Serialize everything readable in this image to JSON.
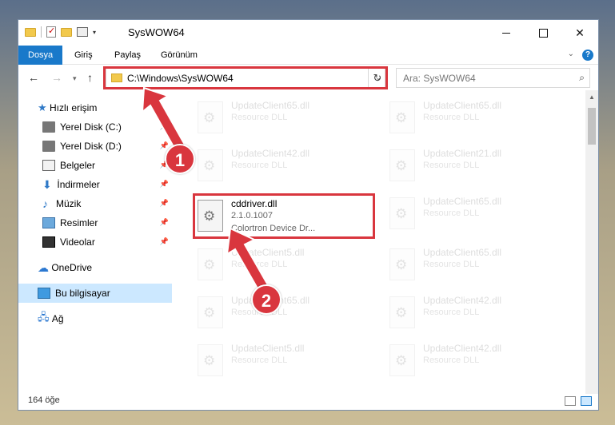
{
  "window": {
    "title": "SysWOW64"
  },
  "ribbon": {
    "tabs": [
      "Dosya",
      "Giriş",
      "Paylaş",
      "Görünüm"
    ]
  },
  "address": {
    "path": "C:\\Windows\\SysWOW64"
  },
  "search": {
    "placeholder": "Ara: SysWOW64"
  },
  "sidebar": {
    "items": [
      {
        "label": "Hızlı erişim",
        "icon": "star-icon"
      },
      {
        "label": "Yerel Disk (C:)",
        "icon": "drive-icon"
      },
      {
        "label": "Yerel Disk (D:)",
        "icon": "drive-icon"
      },
      {
        "label": "Belgeler",
        "icon": "documents-icon"
      },
      {
        "label": "İndirmeler",
        "icon": "downloads-icon"
      },
      {
        "label": "Müzik",
        "icon": "music-icon"
      },
      {
        "label": "Resimler",
        "icon": "pictures-icon"
      },
      {
        "label": "Videolar",
        "icon": "videos-icon"
      },
      {
        "label": "OneDrive",
        "icon": "cloud-icon"
      },
      {
        "label": "Bu bilgisayar",
        "icon": "computer-icon"
      },
      {
        "label": "Ağ",
        "icon": "network-icon"
      }
    ]
  },
  "files": {
    "left": [
      {
        "name": "UpdateClient65.dll",
        "type": "Resource DLL"
      },
      {
        "name": "UpdateClient42.dll",
        "type": "Resource DLL"
      },
      {
        "name": "cddriver.dll",
        "version": "2.1.0.1007",
        "company": "Colortron Device Dr..."
      },
      {
        "name": "UpdateClient5.dll",
        "type": "Resource DLL"
      },
      {
        "name": "UpdateClient65.dll",
        "type": "Resource DLL"
      },
      {
        "name": "UpdateClient5.dll",
        "type": "Resource DLL"
      }
    ],
    "right": [
      {
        "name": "UpdateClient65.dll",
        "type": "Resource DLL"
      },
      {
        "name": "UpdateClient21.dll",
        "type": "Resource DLL"
      },
      {
        "name": "UpdateClient65.dll",
        "type": "Resource DLL"
      },
      {
        "name": "UpdateClient65.dll",
        "type": "Resource DLL"
      },
      {
        "name": "UpdateClient42.dll",
        "type": "Resource DLL"
      },
      {
        "name": "UpdateClient42.dll",
        "type": "Resource DLL"
      }
    ]
  },
  "status": {
    "count": "164 öğe"
  },
  "annotations": {
    "step1": "1",
    "step2": "2",
    "color": "#d9363e"
  },
  "colors": {
    "accent": "#1979ca",
    "selected": "#cce8ff"
  }
}
